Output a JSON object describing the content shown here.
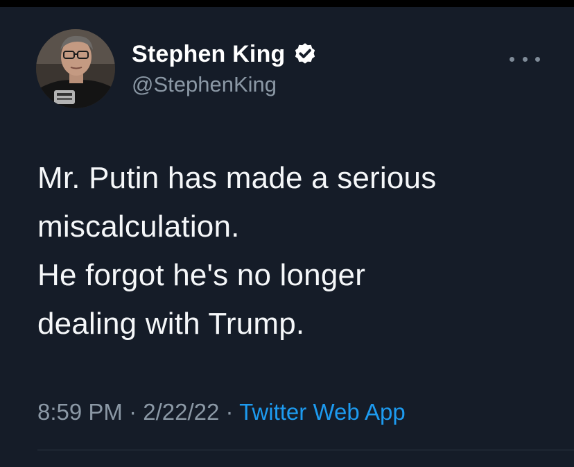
{
  "author": {
    "display_name": "Stephen King",
    "handle": "@StephenKing",
    "verified": true,
    "verified_icon": "verified-badge-icon"
  },
  "menu": {
    "icon": "more-options-icon"
  },
  "tweet": {
    "lines": [
      "Mr. Putin has made a serious",
      "miscalculation.",
      "He forgot he's no longer",
      "dealing with Trump."
    ]
  },
  "meta": {
    "time": "8:59 PM",
    "date": "2/22/22",
    "separator": "·",
    "source": "Twitter Web App"
  },
  "colors": {
    "background": "#151c28",
    "text": "#f5f7f9",
    "secondary": "#8b98a5",
    "link": "#1d9bf0"
  }
}
